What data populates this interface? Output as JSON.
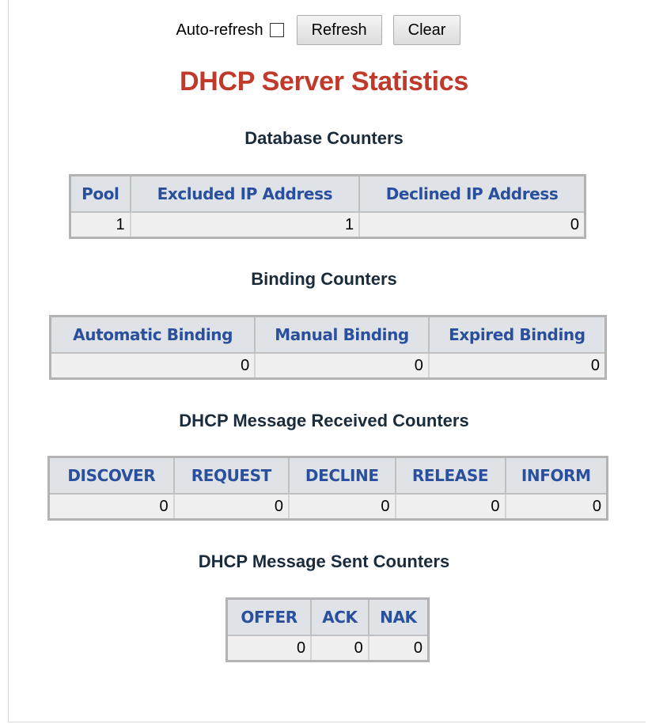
{
  "toolbar": {
    "auto_refresh_label": "Auto-refresh",
    "refresh_label": "Refresh",
    "clear_label": "Clear"
  },
  "title": "DHCP Server Statistics",
  "database": {
    "heading": "Database Counters",
    "headers": [
      "Pool",
      "Excluded IP Address",
      "Declined IP Address"
    ],
    "values": [
      "1",
      "1",
      "0"
    ]
  },
  "binding": {
    "heading": "Binding Counters",
    "headers": [
      "Automatic Binding",
      "Manual Binding",
      "Expired Binding"
    ],
    "values": [
      "0",
      "0",
      "0"
    ]
  },
  "received": {
    "heading": "DHCP Message Received Counters",
    "headers": [
      "DISCOVER",
      "REQUEST",
      "DECLINE",
      "RELEASE",
      "INFORM"
    ],
    "values": [
      "0",
      "0",
      "0",
      "0",
      "0"
    ]
  },
  "sent": {
    "heading": "DHCP Message Sent Counters",
    "headers": [
      "OFFER",
      "ACK",
      "NAK"
    ],
    "values": [
      "0",
      "0",
      "0"
    ]
  },
  "colors": {
    "title": "#c0392b",
    "header_text": "#2a4f9c",
    "header_bg": "#dfe3e8",
    "cell_bg": "#f0f0f0"
  }
}
